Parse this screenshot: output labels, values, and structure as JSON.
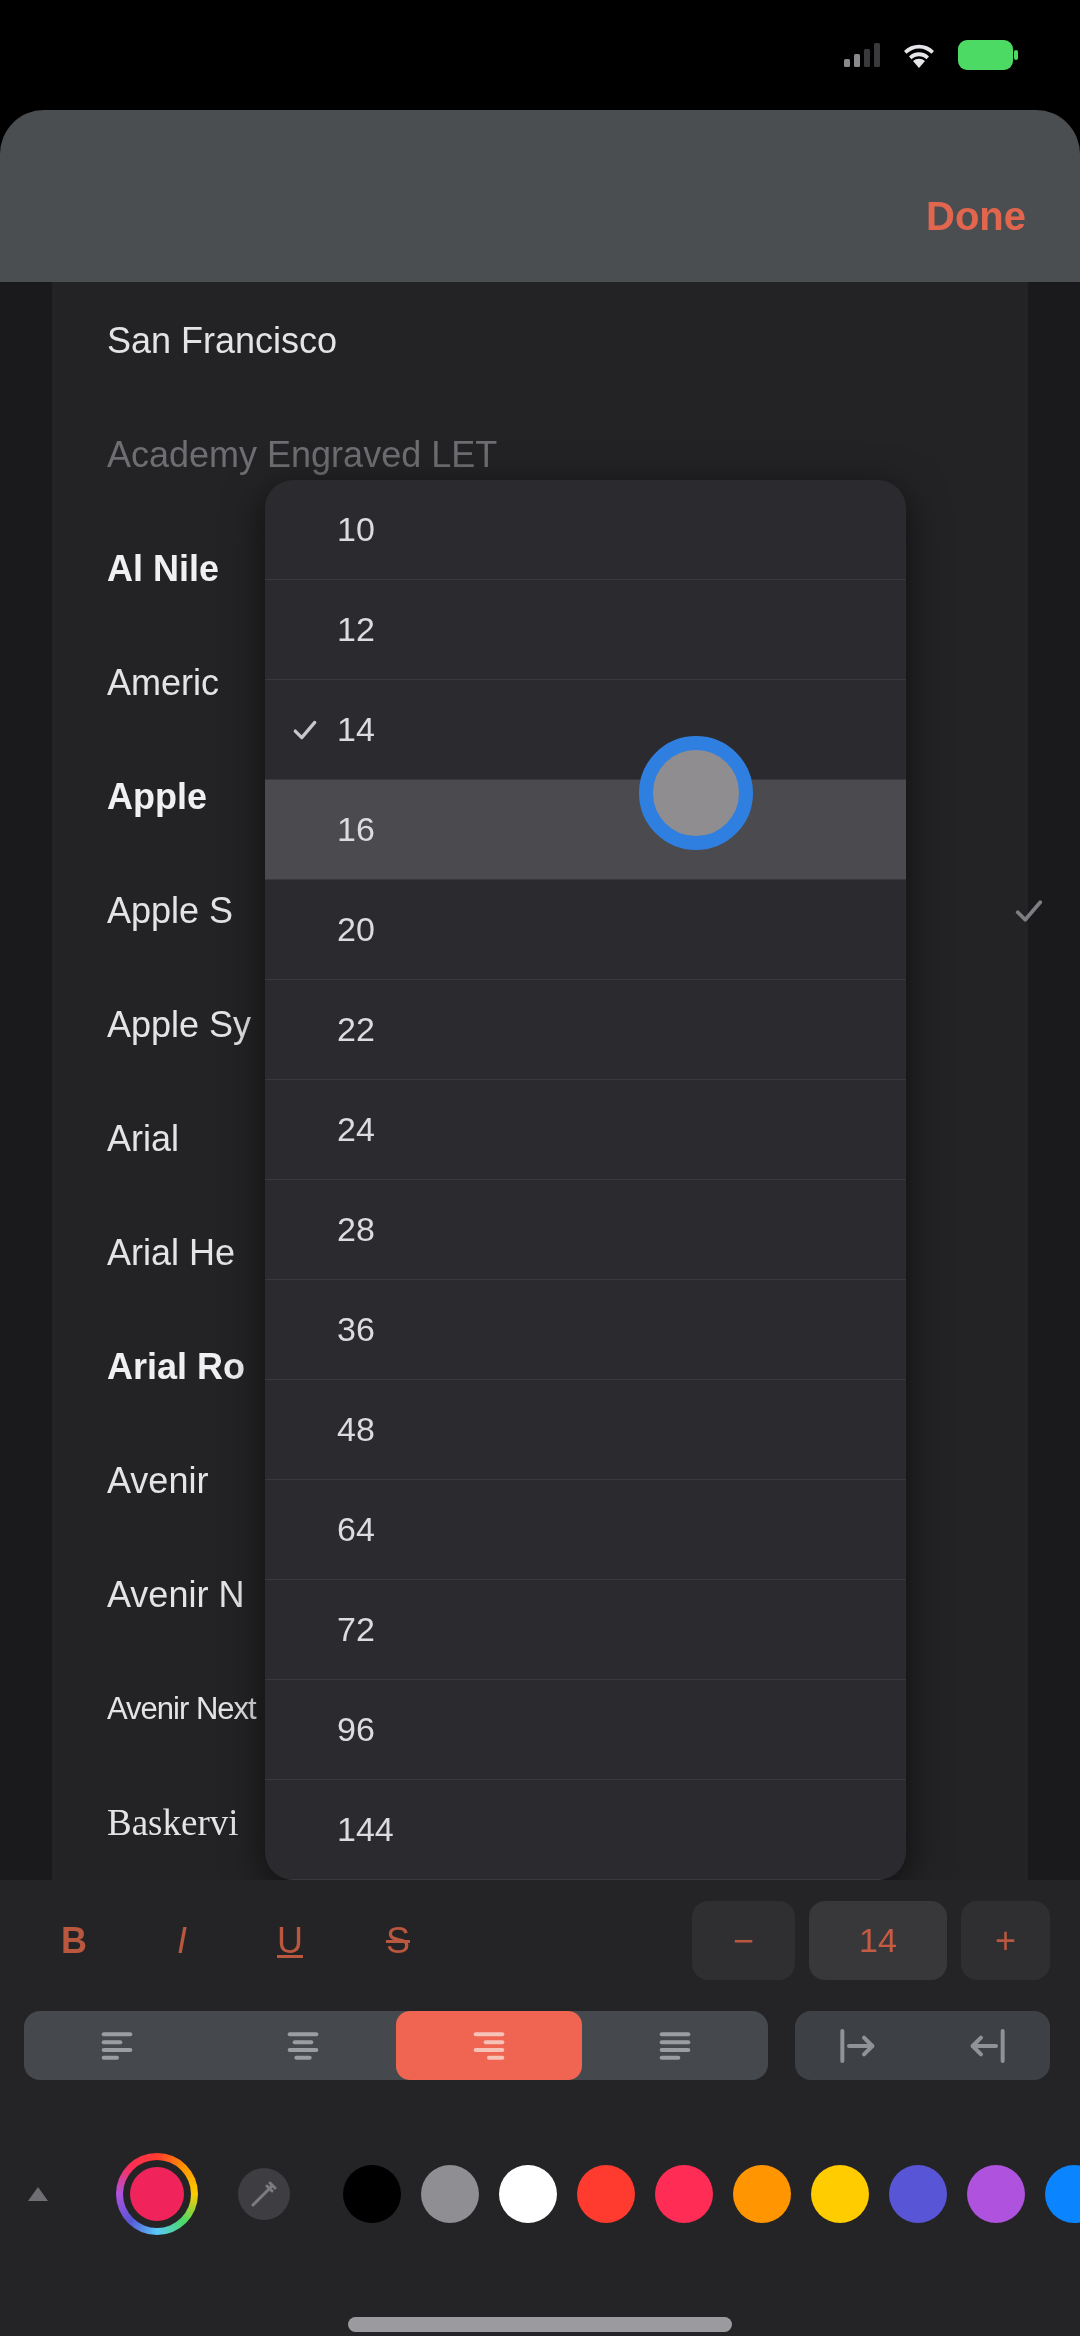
{
  "header": {
    "done_button": "Done"
  },
  "font_list": {
    "items": [
      {
        "label": "San Francisco",
        "kind": "regular",
        "selected": false
      },
      {
        "label": "Academy Engraved LET",
        "kind": "faint",
        "selected": false
      },
      {
        "label": "Al Nile",
        "kind": "bold",
        "selected": false
      },
      {
        "label": "Americ",
        "kind": "regular",
        "selected": false
      },
      {
        "label": "Apple",
        "kind": "bold",
        "selected": false
      },
      {
        "label": "Apple S",
        "kind": "regular",
        "selected": true
      },
      {
        "label": "Apple Sy",
        "kind": "regular",
        "selected": false
      },
      {
        "label": "Arial",
        "kind": "regular",
        "selected": false
      },
      {
        "label": "Arial He",
        "kind": "regular",
        "selected": false
      },
      {
        "label": "Arial Ro",
        "kind": "bold",
        "selected": false
      },
      {
        "label": "Avenir",
        "kind": "regular",
        "selected": false
      },
      {
        "label": "Avenir N",
        "kind": "regular",
        "selected": false
      },
      {
        "label": "Avenir Next",
        "kind": "condensed",
        "selected": false
      },
      {
        "label": "Baskervi",
        "kind": "serif",
        "selected": false
      }
    ]
  },
  "size_menu": {
    "items": [
      {
        "label": "10",
        "checked": false,
        "highlighted": false
      },
      {
        "label": "12",
        "checked": false,
        "highlighted": false
      },
      {
        "label": "14",
        "checked": true,
        "highlighted": false
      },
      {
        "label": "16",
        "checked": false,
        "highlighted": true
      },
      {
        "label": "20",
        "checked": false,
        "highlighted": false
      },
      {
        "label": "22",
        "checked": false,
        "highlighted": false
      },
      {
        "label": "24",
        "checked": false,
        "highlighted": false
      },
      {
        "label": "28",
        "checked": false,
        "highlighted": false
      },
      {
        "label": "36",
        "checked": false,
        "highlighted": false
      },
      {
        "label": "48",
        "checked": false,
        "highlighted": false
      },
      {
        "label": "64",
        "checked": false,
        "highlighted": false
      },
      {
        "label": "72",
        "checked": false,
        "highlighted": false
      },
      {
        "label": "96",
        "checked": false,
        "highlighted": false
      },
      {
        "label": "144",
        "checked": false,
        "highlighted": false
      }
    ]
  },
  "format_toolbar": {
    "style_buttons": [
      {
        "label": "B",
        "kind": "bold"
      },
      {
        "label": "I",
        "kind": "italic"
      },
      {
        "label": "U",
        "kind": "underline"
      },
      {
        "label": "S",
        "kind": "strikethrough"
      }
    ],
    "size_stepper": {
      "decrease": "−",
      "value": "14",
      "increase": "+"
    }
  },
  "alignment": [
    {
      "kind": "left",
      "selected": false
    },
    {
      "kind": "center",
      "selected": false
    },
    {
      "kind": "right",
      "selected": true
    },
    {
      "kind": "justify",
      "selected": false
    }
  ],
  "direction_buttons": [
    {
      "kind": "left_to_right"
    },
    {
      "kind": "right_to_left"
    }
  ],
  "colors": {
    "color_wheel": {
      "color": "#f0245a"
    },
    "swatches": [
      {
        "color": "#000000",
        "selected": false
      },
      {
        "color": "#8e8e93",
        "selected": false
      },
      {
        "color": "#ffffff",
        "selected": false
      },
      {
        "color": "#ff3b30",
        "selected": false
      },
      {
        "color": "#ff2d55",
        "selected": false
      },
      {
        "color": "#ff9500",
        "selected": false
      },
      {
        "color": "#ffcc00",
        "selected": false
      },
      {
        "color": "#5856d6",
        "selected": false
      },
      {
        "color": "#af52de",
        "selected": false
      },
      {
        "color": "#0a84ff",
        "selected": false
      }
    ]
  }
}
